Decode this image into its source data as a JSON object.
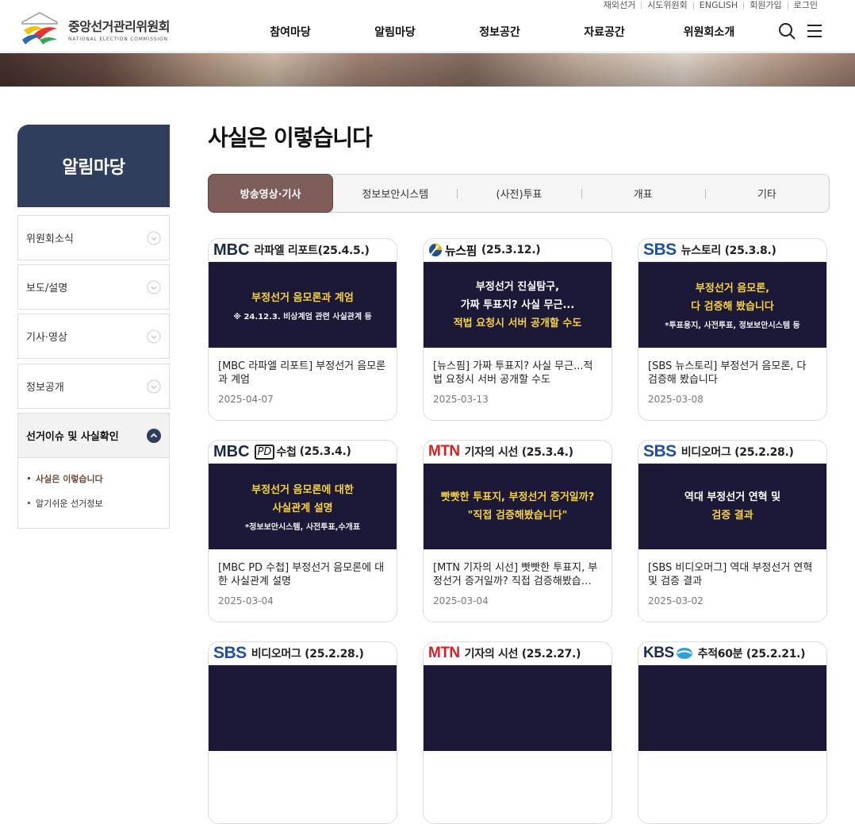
{
  "header": {
    "utility": [
      "재외선거",
      "시도위원회",
      "ENGLISH",
      "회원가입",
      "로그인"
    ],
    "logo_ko": "중앙선거관리위원회",
    "logo_en": "NATIONAL ELECTION COMMISSION",
    "gnb": [
      "참여마당",
      "알림마당",
      "정보공간",
      "자료공간",
      "위원회소개"
    ]
  },
  "sidebar": {
    "title": "알림마당",
    "items": [
      "위원회소식",
      "보도/설명",
      "기사·영상",
      "정보공개",
      "선거이슈 및 사실확인"
    ],
    "sub_items": [
      "사실은 이렇습니다",
      "알기쉬운 선거정보"
    ]
  },
  "main": {
    "title": "사실은 이렇습니다",
    "tabs": [
      "방송영상·기사",
      "정보보안시스템",
      "(사전)투표",
      "개표",
      "기타"
    ],
    "cards": [
      {
        "brand": "MBC",
        "program": "라파엘 리포트(25.4.5.)",
        "thumb": [
          "부정선거 음모론과 계엄"
        ],
        "thumb_small": "※ 24.12.3. 비상계엄 관련 사실관계 등",
        "title": "[MBC 라파엘 리포트] 부정선거 음모론과 계엄",
        "date": "2025-04-07"
      },
      {
        "brand": "뉴스핌",
        "program": "(25.3.12.)",
        "thumb": [
          "부정선거 진실탐구,",
          "가짜 투표지? 사실 무근...",
          "적법 요청시 서버 공개할 수도"
        ],
        "thumb_small": "",
        "title": "[뉴스핌] 가짜 투표지? 사실 무근...적법 요청시 서버 공개할 수도",
        "date": "2025-03-13"
      },
      {
        "brand": "SBS",
        "program": "뉴스토리 (25.3.8.)",
        "thumb": [
          "부정선거 음모론,",
          "다 검증해 봤습니다"
        ],
        "thumb_small": "*투표용지, 사전투표, 정보보안시스템 등",
        "title": "[SBS 뉴스토리] 부정선거 음모론, 다 검증해 봤습니다",
        "date": "2025-03-08"
      },
      {
        "brand": "MBC",
        "pd": "PD",
        "program_prefix": "수첩",
        "program": "(25.3.4.)",
        "thumb": [
          "부정선거 음모론에 대한",
          "사실관계 설명"
        ],
        "thumb_small": "*정보보안시스템, 사전투표,수개표",
        "title": "[MBC PD 수첩] 부정선거 음모론에 대한 사실관계 설명",
        "date": "2025-03-04"
      },
      {
        "brand": "MTN",
        "program": "기자의 시선 (25.3.4.)",
        "thumb": [
          "빳빳한 투표지, 부정선거 증거일까?",
          "\"직접 검증해봤습니다\""
        ],
        "thumb_small": "",
        "title": "[MTN 기자의 시선] 빳빳한 투표지, 부정선거 증거일까? 직접 검증해봤습…",
        "date": "2025-03-04"
      },
      {
        "brand": "SBS",
        "program": "비디오머그 (25.2.28.)",
        "thumb": [
          "역대 부정선거 연혁 및",
          "검증 결과"
        ],
        "thumb_small": "",
        "title": "[SBS 비디오머그] 역대 부정선거 연혁 및 검증 결과",
        "date": "2025-03-02"
      },
      {
        "brand": "SBS",
        "program": "비디오머그 (25.2.28.)",
        "thumb": [],
        "thumb_small": "",
        "title": "",
        "date": ""
      },
      {
        "brand": "MTN",
        "program": "기자의 시선 (25.2.27.)",
        "thumb": [],
        "thumb_small": "",
        "title": "",
        "date": ""
      },
      {
        "brand": "KBS",
        "program": "추적60분 (25.2.21.)",
        "thumb": [],
        "thumb_small": "",
        "title": "",
        "date": ""
      }
    ]
  },
  "colors": {
    "sidebar_title_bg": "#2e3e5c",
    "tab_active_bg": "#7d5e5a",
    "thumb_bg": "#1c1838",
    "thumb_highlight": "#f5d43b",
    "mbc": "#1c2a48",
    "sbs": "#1d4fa3",
    "mtn": "#d91f26"
  }
}
